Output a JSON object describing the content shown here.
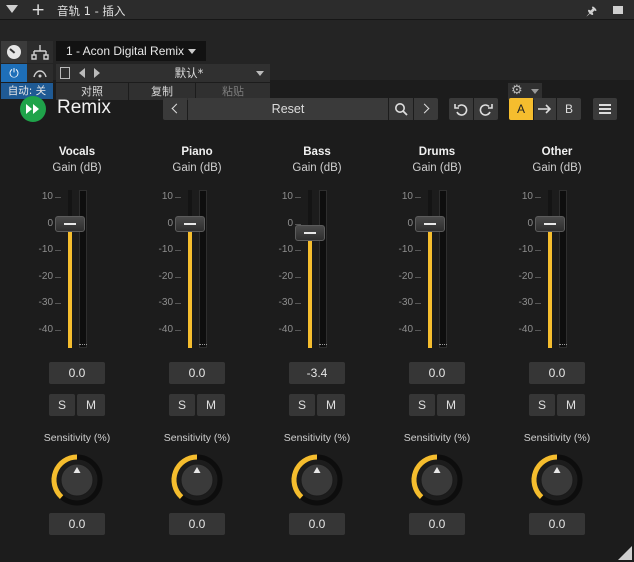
{
  "host": {
    "window_title": "音轨 1 - 插入",
    "plugin_slot": "1 - Acon Digital Remix",
    "preset_name": "默认*",
    "auto_label": "自动: 关",
    "compare_label": "对照",
    "copy_label": "复制",
    "paste_label": "粘贴",
    "icons": {
      "menu": "dropdown-arrow-icon",
      "add": "plus-icon",
      "pin": "pin-icon",
      "close": "close-icon",
      "power": "power-icon",
      "routing": "routing-icon",
      "gear": "gear-icon"
    }
  },
  "plugin": {
    "title": "Remix",
    "preset": "Reset",
    "ab_a": "A",
    "ab_b": "B",
    "accent_color": "#f5bd2e",
    "logo_color": "#1fa34a"
  },
  "scale": {
    "ticks": [
      "10",
      "0",
      "-10",
      "-20",
      "-30",
      "-40"
    ],
    "min_db": -48,
    "max_db": 10
  },
  "channels": [
    {
      "name": "Vocals",
      "sub": "Gain (dB)",
      "gain_db": 0.0,
      "gain_display": "0.0",
      "solo": "S",
      "mute": "M",
      "sens_label": "Sensitivity (%)",
      "sensitivity": 0.0,
      "sens_display": "0.0"
    },
    {
      "name": "Piano",
      "sub": "Gain (dB)",
      "gain_db": 0.0,
      "gain_display": "0.0",
      "solo": "S",
      "mute": "M",
      "sens_label": "Sensitivity (%)",
      "sensitivity": 0.0,
      "sens_display": "0.0"
    },
    {
      "name": "Bass",
      "sub": "Gain (dB)",
      "gain_db": -3.4,
      "gain_display": "-3.4",
      "solo": "S",
      "mute": "M",
      "sens_label": "Sensitivity (%)",
      "sensitivity": 0.0,
      "sens_display": "0.0"
    },
    {
      "name": "Drums",
      "sub": "Gain (dB)",
      "gain_db": 0.0,
      "gain_display": "0.0",
      "solo": "S",
      "mute": "M",
      "sens_label": "Sensitivity (%)",
      "sensitivity": 0.0,
      "sens_display": "0.0"
    },
    {
      "name": "Other",
      "sub": "Gain (dB)",
      "gain_db": 0.0,
      "gain_display": "0.0",
      "solo": "S",
      "mute": "M",
      "sens_label": "Sensitivity (%)",
      "sensitivity": 0.0,
      "sens_display": "0.0"
    }
  ]
}
